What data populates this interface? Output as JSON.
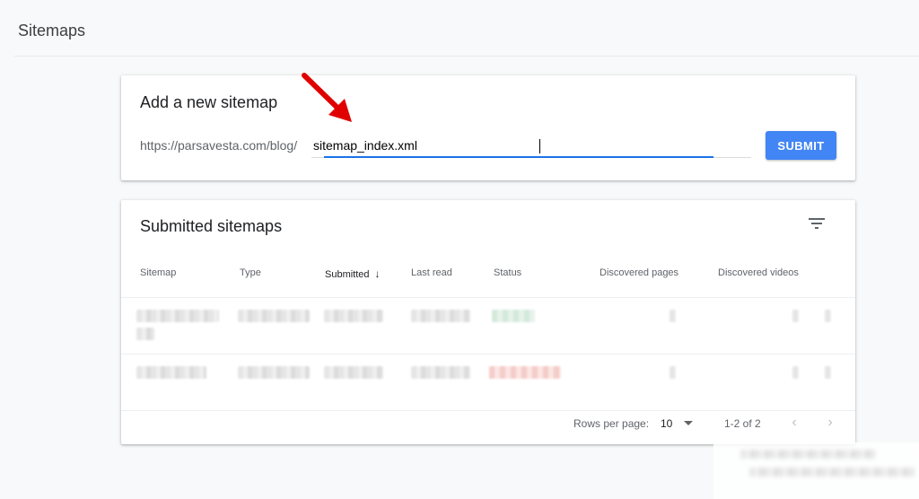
{
  "page": {
    "title": "Sitemaps"
  },
  "add_sitemap": {
    "title": "Add a new sitemap",
    "url_prefix": "https://parsavesta.com/blog/",
    "input_value": "sitemap_index.xml",
    "submit_label": "SUBMIT"
  },
  "submitted": {
    "title": "Submitted sitemaps",
    "columns": [
      "Sitemap",
      "Type",
      "Submitted",
      "Last read",
      "Status",
      "Discovered pages",
      "Discovered videos"
    ],
    "sorted_column": "Submitted",
    "sort_direction": "descending"
  },
  "pagination": {
    "rows_label": "Rows per page:",
    "rows_value": "10",
    "range": "1-2 of 2"
  },
  "icons": {
    "filter": "filter-icon",
    "sort": "arrow-down-icon",
    "dropdown": "dropdown-icon",
    "prev": "chevron-left-icon",
    "next": "chevron-right-icon"
  },
  "colors": {
    "accent": "#4285f4",
    "focus": "#1a73e8",
    "annotation_arrow": "#e00000"
  }
}
